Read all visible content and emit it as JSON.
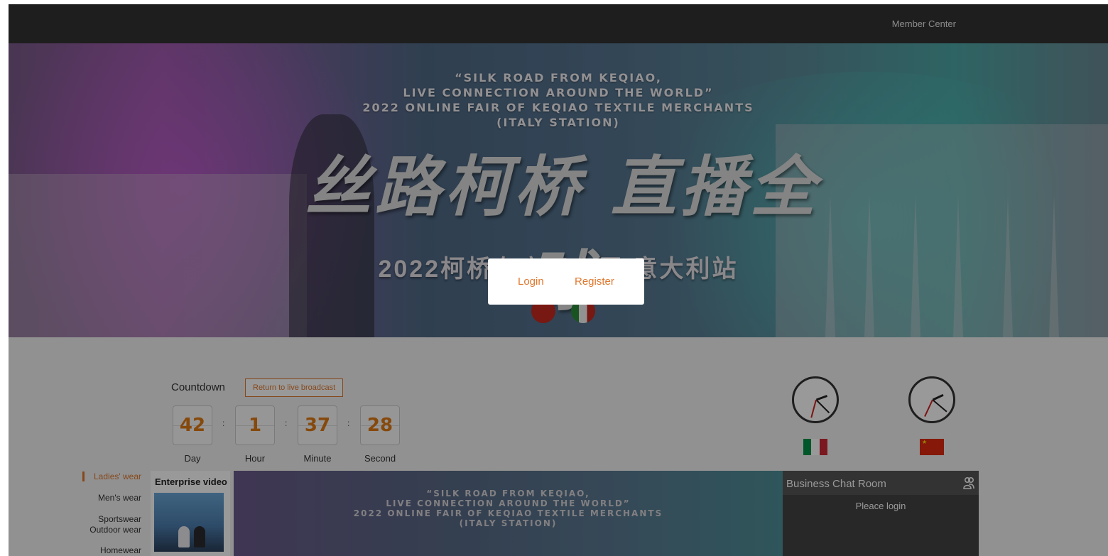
{
  "topbar": {
    "member_center": "Member Center"
  },
  "banner": {
    "title_lines": [
      "“SILK ROAD FROM KEQIAO,",
      "LIVE CONNECTION AROUND THE WORLD”",
      "2022 ONLINE FAIR OF KEQIAO TEXTILE MERCHANTS",
      "(ITALY STATION)"
    ],
    "calligraphy": "丝路柯桥 直播全球",
    "subtitle": "2022柯桥布商云商展 意大利站"
  },
  "auth": {
    "login": "Login",
    "register": "Register"
  },
  "countdown": {
    "label": "Countdown",
    "return_button": "Return to live broadcast",
    "separator": ":",
    "units": [
      {
        "value": "42",
        "label": "Day"
      },
      {
        "value": "1",
        "label": "Hour"
      },
      {
        "value": "37",
        "label": "Minute"
      },
      {
        "value": "28",
        "label": "Second"
      }
    ]
  },
  "clocks": [
    {
      "country": "Italy",
      "flag_colors": [
        "#009246",
        "#ffffff",
        "#ce2b37"
      ]
    },
    {
      "country": "China",
      "flag_colors": [
        "#de2910",
        "#ffde00"
      ]
    }
  ],
  "categories": [
    {
      "label": "Ladies' wear",
      "active": true
    },
    {
      "label": "Men's wear",
      "active": false
    },
    {
      "label": "Sportswear",
      "active": false
    },
    {
      "label": "Outdoor wear",
      "active": false
    },
    {
      "label": "Homewear",
      "active": false
    }
  ],
  "enterprise_video": {
    "title": "Enterprise video"
  },
  "video": {
    "title_lines": [
      "“SILK ROAD FROM KEQIAO,",
      "LIVE CONNECTION AROUND THE WORLD”",
      "2022 ONLINE FAIR OF KEQIAO TEXTILE MERCHANTS",
      "(ITALY STATION)"
    ]
  },
  "chat": {
    "title": "Business Chat Room",
    "login_prompt": "Pleace login"
  },
  "colors": {
    "accent": "#e0782e",
    "topbar": "#333333",
    "chat_bg": "#4a4a4a"
  }
}
